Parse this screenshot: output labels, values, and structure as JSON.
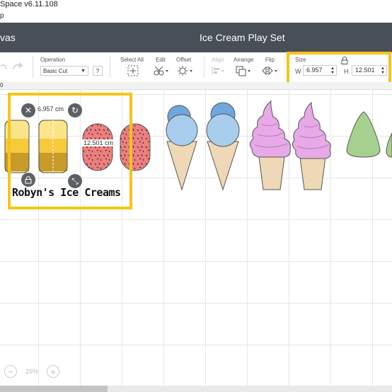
{
  "titlebar": {
    "title": "Space  v6.11.108",
    "menu": "p"
  },
  "header": {
    "canvas_label": "vas",
    "project_title": "Ice Cream Play Set"
  },
  "toolbar": {
    "operation_label": "Operation",
    "operation_value": "Basic Cut",
    "help_button": "?",
    "select_all_label": "Select All",
    "edit_label": "Edit",
    "offset_label": "Offset",
    "align_label": "Align",
    "arrange_label": "Arrange",
    "flip_label": "Flip",
    "size_label": "Size",
    "width_label": "W",
    "width_value": "6.957",
    "height_label": "H",
    "height_value": "12.501"
  },
  "ruler": {
    "origin": "0"
  },
  "selection": {
    "width_readout": "6.957 cm",
    "height_readout": "12.501 cm",
    "text_object": "Robyn's Ice Creams"
  },
  "zoom": {
    "level": "25%",
    "minus": "−",
    "plus": "+"
  },
  "colors": {
    "header_bg": "#494f56",
    "highlight": "#f5c518",
    "popsicle_yellow": "#fbe58a",
    "popsicle_gold": "#e9b21f",
    "popsicle_pink": "#ee7f7f",
    "scoop_blue": "#a9cdec",
    "scoop_dark_blue": "#6fa6dd",
    "cone_tan": "#efd8b6",
    "swirl_purple": "#e7a9e7",
    "wedge_green": "#a6d08f"
  }
}
